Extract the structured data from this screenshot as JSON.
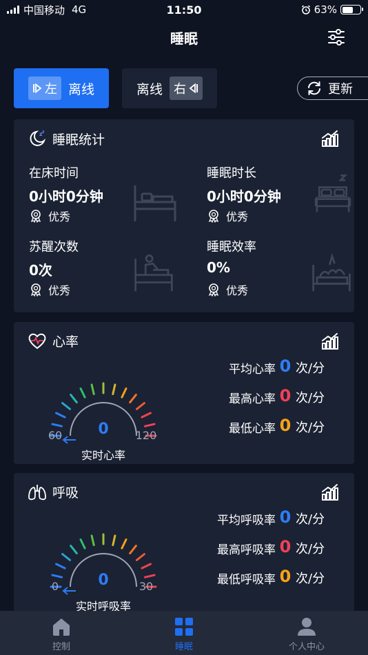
{
  "status_bar": {
    "carrier": "中国移动",
    "network": "4G",
    "time": "11:50",
    "battery": "63%",
    "battery_level": 0.63
  },
  "nav": {
    "title": "睡眠",
    "settings_icon": "sliders-icon"
  },
  "modes": {
    "left": {
      "tag": "左",
      "label": "离线"
    },
    "right": {
      "tag": "右",
      "label": "离线"
    },
    "selected": "left"
  },
  "update_button": {
    "label": "更新"
  },
  "sleep_stats": {
    "title": "睡眠统计",
    "items": [
      {
        "label": "在床时间",
        "value": "0小时0分钟",
        "rating": "优秀",
        "icon": "bed-icon"
      },
      {
        "label": "睡眠时长",
        "value": "0小时0分钟",
        "rating": "优秀",
        "icon": "bed-sleep-icon"
      },
      {
        "label": "苏醒次数",
        "value": "0次",
        "rating": "优秀",
        "icon": "bed-awake-icon"
      },
      {
        "label": "睡眠效率",
        "value": "0%",
        "rating": "优秀",
        "icon": "bed-efficiency-icon"
      }
    ]
  },
  "heart_rate": {
    "title": "心率",
    "gauge": {
      "value": "0",
      "min": "60",
      "max": "120",
      "caption": "实时心率"
    },
    "rows": [
      {
        "label": "平均心率",
        "value": "0",
        "unit": "次/分",
        "color": "#2e7cf6"
      },
      {
        "label": "最高心率",
        "value": "0",
        "unit": "次/分",
        "color": "#f04058"
      },
      {
        "label": "最低心率",
        "value": "0",
        "unit": "次/分",
        "color": "#f5a11a"
      }
    ]
  },
  "breathing": {
    "title": "呼吸",
    "gauge": {
      "value": "0",
      "min": "0",
      "max": "30",
      "caption": "实时呼吸率"
    },
    "rows": [
      {
        "label": "平均呼吸率",
        "value": "0",
        "unit": "次/分",
        "color": "#2e7cf6"
      },
      {
        "label": "最高呼吸率",
        "value": "0",
        "unit": "次/分",
        "color": "#f04058"
      },
      {
        "label": "最低呼吸率",
        "value": "0",
        "unit": "次/分",
        "color": "#f5a11a"
      }
    ]
  },
  "tabs": [
    {
      "label": "控制",
      "icon": "home-icon"
    },
    {
      "label": "睡眠",
      "icon": "grid-icon"
    },
    {
      "label": "个人中心",
      "icon": "user-icon"
    }
  ],
  "active_tab": "睡眠",
  "colors": {
    "accent": "#1e6ff1",
    "background": "#0f1422",
    "card": "#1b2233"
  }
}
